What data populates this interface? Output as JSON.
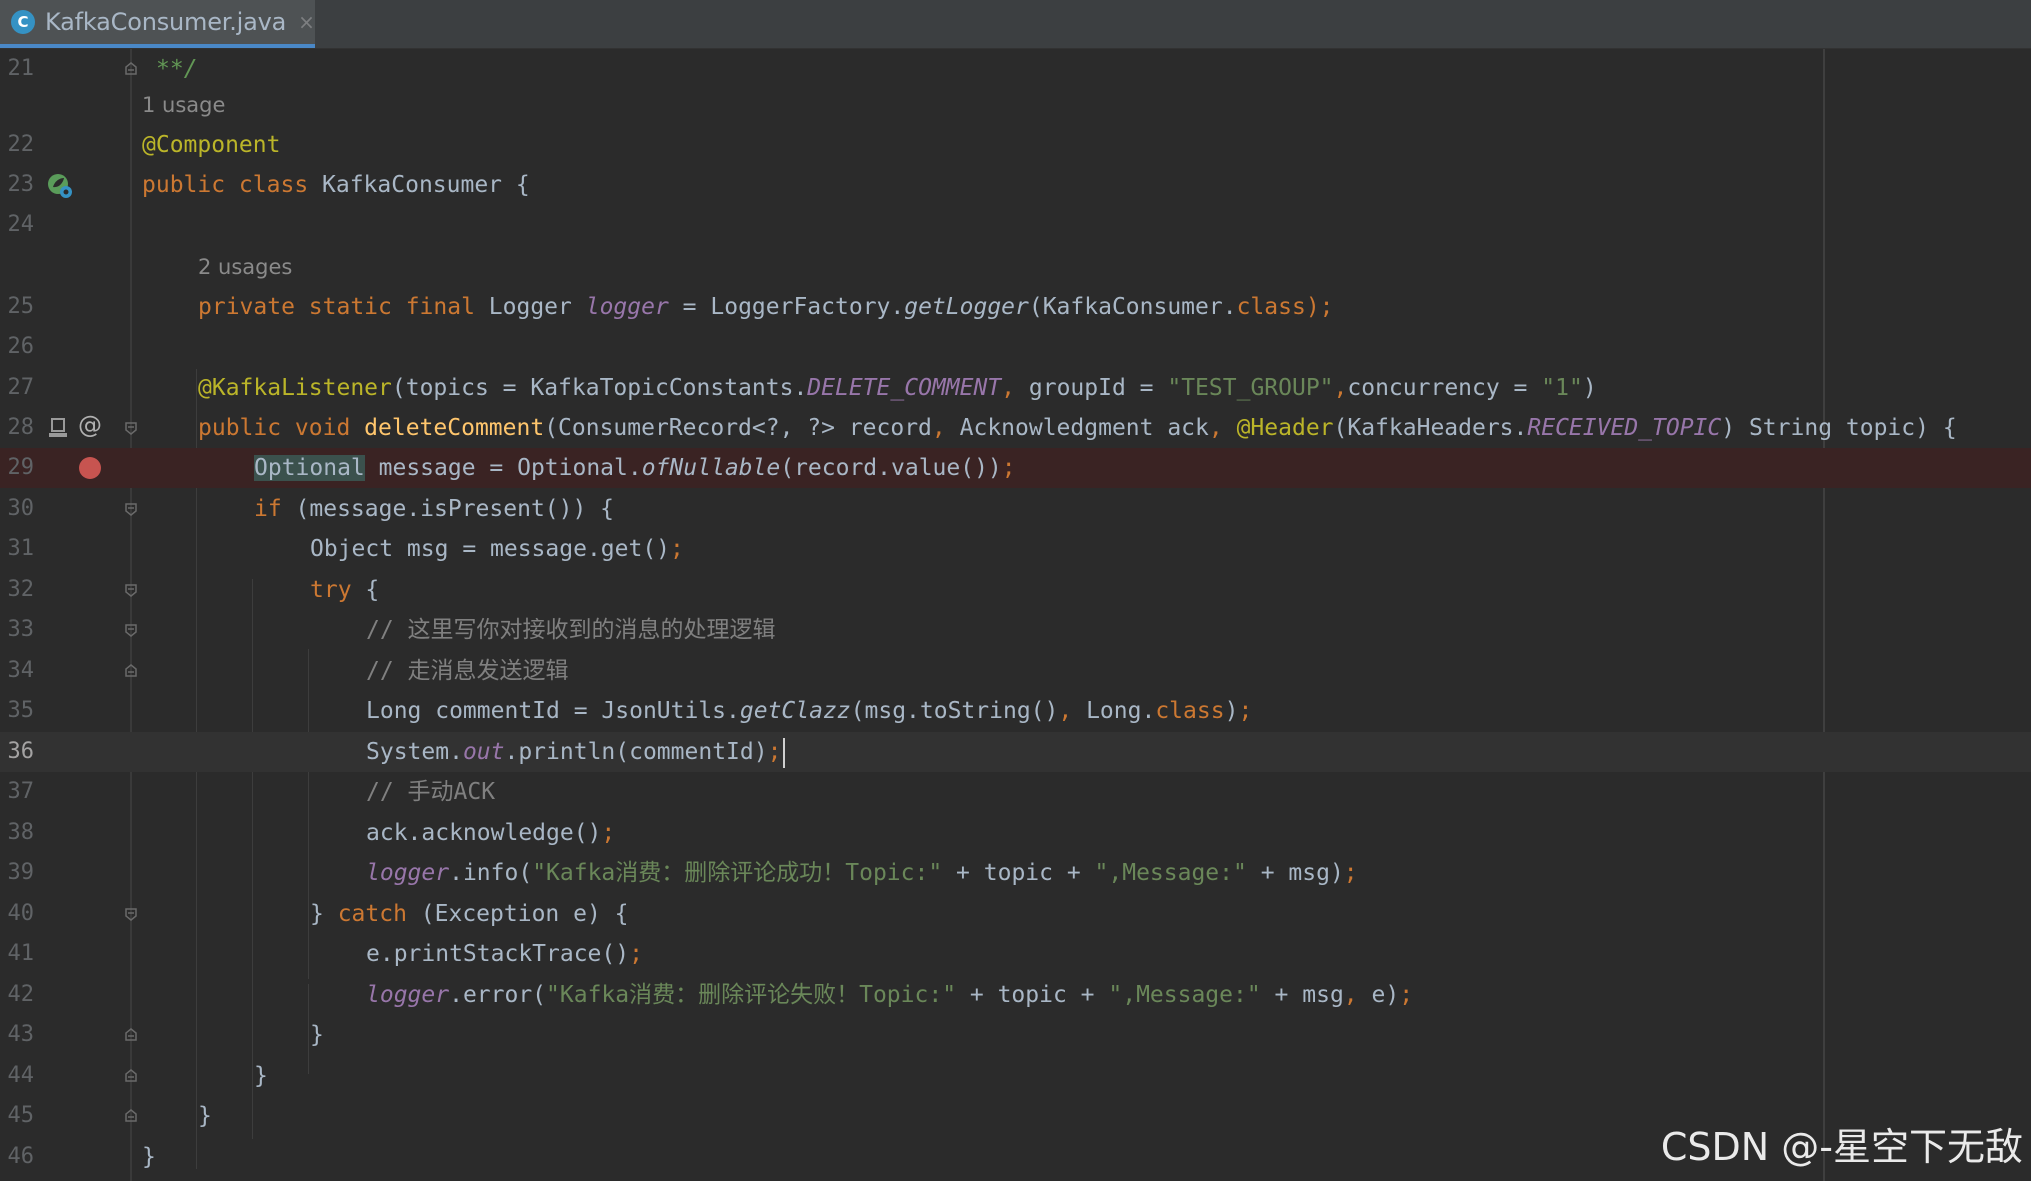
{
  "tab": {
    "icon_letter": "C",
    "title": "KafkaConsumer.java",
    "close": "×"
  },
  "hints": {
    "class_usages": "1 usage",
    "logger_usages": "2 usages"
  },
  "code": {
    "l21": "**/",
    "l22_annotation": "@Component",
    "l23_kw": "public class ",
    "l23_rest": "KafkaConsumer {",
    "l25_kw": "private static final ",
    "l25_type": "Logger ",
    "l25_field": "logger",
    "l25_eq": " = LoggerFactory.",
    "l25_method": "getLogger",
    "l25_args": "(KafkaConsumer.",
    "l25_class_kw": "class",
    "l25_end": ");",
    "l27_annotation": "@KafkaListener",
    "l27_a": "(topics = KafkaTopicConstants.",
    "l27_const": "DELETE_COMMENT",
    "l27_comma1": ", ",
    "l27_b": "groupId = ",
    "l27_group": "\"TEST_GROUP\"",
    "l27_comma2": ",",
    "l27_c": "concurrency = ",
    "l27_conc": "\"1\"",
    "l27_end": ")",
    "l28_kw": "public void ",
    "l28_method": "deleteComment",
    "l28_a": "(ConsumerRecord<?, ?> record",
    "l28_comma1": ", ",
    "l28_b": "Acknowledgment ack",
    "l28_comma2": ", ",
    "l28_header": "@Header",
    "l28_c": "(KafkaHeaders.",
    "l28_const": "RECEIVED_TOPIC",
    "l28_d": ") String topic) {",
    "l29_type": "Optional",
    "l29_a": " message = Optional.",
    "l29_method": "ofNullable",
    "l29_b": "(record.value())",
    "l29_semi": ";",
    "l30_kw": "if ",
    "l30_rest": "(message.isPresent()) {",
    "l31_a": "Object msg = message.get()",
    "l31_semi": ";",
    "l32_kw": "try ",
    "l32_rest": "{",
    "l33_comment": "// 这里写你对接收到的消息的处理逻辑",
    "l34_comment": "// 走消息发送逻辑",
    "l35_a": "Long commentId = JsonUtils.",
    "l35_method": "getClazz",
    "l35_b": "(msg.toString()",
    "l35_comma": ", ",
    "l35_c": "Long.",
    "l35_class_kw": "class",
    "l35_d": ")",
    "l35_semi": ";",
    "l36_a": "System.",
    "l36_field": "out",
    "l36_b": ".println(commentId)",
    "l36_semi": ";",
    "l37_comment": "// 手动ACK",
    "l38_a": "ack.acknowledge()",
    "l38_semi": ";",
    "l39_field": "logger",
    "l39_a": ".info(",
    "l39_str1": "\"Kafka消费：删除评论成功！Topic:\"",
    "l39_b": " + topic + ",
    "l39_str2": "\",Message:\"",
    "l39_c": " + msg)",
    "l39_semi": ";",
    "l40_a": "} ",
    "l40_kw": "catch ",
    "l40_rest": "(Exception e) {",
    "l41_a": "e.printStackTrace()",
    "l41_semi": ";",
    "l42_field": "logger",
    "l42_a": ".error(",
    "l42_str1": "\"Kafka消费：删除评论失败！Topic:\"",
    "l42_b": " + topic + ",
    "l42_str2": "\",Message:\"",
    "l42_c": " + msg",
    "l42_comma": ", ",
    "l42_d": "e)",
    "l42_semi": ";",
    "l43": "}",
    "l44": "}",
    "l45": "}",
    "l46": "}"
  },
  "line_numbers": [
    "21",
    "22",
    "23",
    "24",
    "25",
    "26",
    "27",
    "28",
    "29",
    "30",
    "31",
    "32",
    "33",
    "34",
    "35",
    "36",
    "37",
    "38",
    "39",
    "40",
    "41",
    "42",
    "43",
    "44",
    "45",
    "46"
  ],
  "gutter": {
    "at_sign": "@"
  },
  "watermark": "CSDN @-星空下无敌",
  "colors": {
    "background": "#2b2b2b",
    "keyword": "#cc7832",
    "annotation": "#bbb529",
    "method_decl": "#ffc66d",
    "string": "#6a8759",
    "field": "#9876aa",
    "comment": "#808080",
    "breakpoint": "#c75450",
    "tab_underline": "#4a88c7"
  }
}
